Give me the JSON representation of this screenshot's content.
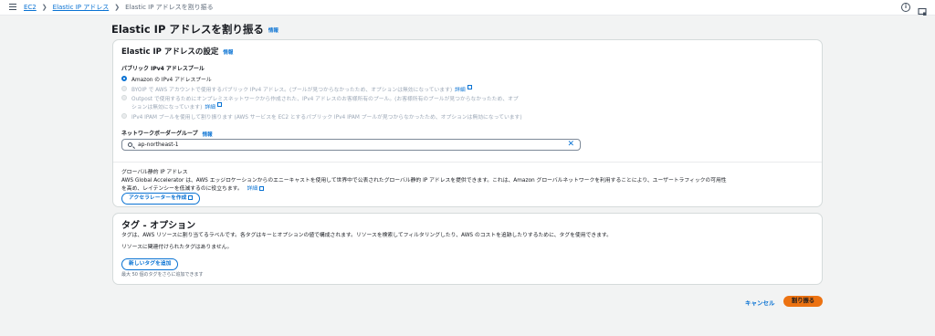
{
  "breadcrumb": {
    "items": [
      "EC2",
      "Elastic IP アドレス"
    ],
    "current": "Elastic IP アドレスを割り振る"
  },
  "page": {
    "title": "Elastic IP アドレスを割り振る",
    "info": "情報"
  },
  "settings": {
    "title": "Elastic IP アドレスの設定",
    "info": "情報",
    "pool_label": "パブリック IPv4 アドレスプール",
    "options": [
      {
        "label": "Amazon の IPv4 アドレスプール"
      },
      {
        "label": "BYOIP で AWS アカウントで使用するパブリック IPv4 アドレス。(プールが見つからなかったため、オプションは無効になっています)",
        "link": "詳細"
      },
      {
        "label": "Outpost で使用するためにオンプレミスネットワークから作成された、IPv4 アドレスのお客様所有のプール。(お客様所有のプールが見つからなかったため、オプ",
        "label2": "ションは無効になっています)",
        "link": "詳細"
      },
      {
        "label": "IPv4 IPAM プールを使用して割り振ります (AWS サービスを EC2 とするパブリック IPv4 IPAM プールが見つからなかったため、オプションは無効になっています)"
      }
    ],
    "border_group_label": "ネットワークボーダーグループ",
    "border_group_info": "情報",
    "border_group_value": "ap-northeast-1",
    "global_title": "グローバル静的 IP アドレス",
    "global_line1": "AWS Global Accelerator は、AWS エッジロケーションからのエニーキャストを使用して世界中で公表されたグローバル静的 IP アドレスを提供できます。これは、Amazon グローバルネットワークを利用することにより、ユーザートラフィックの可用性",
    "global_line2": "を高め、レイテンシーを低減するのに役立ちます。",
    "global_link": "詳細",
    "accelerator_button": "アクセラレーターを作成"
  },
  "tags": {
    "title": "タグ - オプション",
    "description": "タグは、AWS リソースに割り当てるラベルです。各タグはキーとオプションの値で構成されます。リソースを検索してフィルタリングしたり、AWS のコストを追跡したりするために、タグを使用できます。",
    "empty": "リソースに関連付けられたタグはありません。",
    "add_button": "新しいタグを追加",
    "hint": "最大 50 個のタグをさらに追加できます"
  },
  "footer": {
    "cancel": "キャンセル",
    "submit": "割り振る"
  },
  "colors": {
    "link": "#0972d3",
    "primary_button": "#ec7211"
  }
}
